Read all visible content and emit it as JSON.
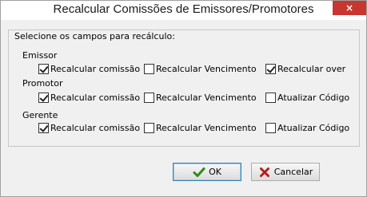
{
  "window": {
    "title": "Recalcular Comissões de Emissores/Promotores",
    "close_glyph": "×"
  },
  "group": {
    "title": "Selecione os campos para recálculo:"
  },
  "sections": [
    {
      "label": "Emissor",
      "options": [
        {
          "label": "Recalcular comissão",
          "checked": true
        },
        {
          "label": "Recalcular Vencimento",
          "checked": false
        },
        {
          "label": "Recalcular over",
          "checked": true
        }
      ]
    },
    {
      "label": "Promotor",
      "options": [
        {
          "label": "Recalcular comissão",
          "checked": true
        },
        {
          "label": "Recalcular Vencimento",
          "checked": false
        },
        {
          "label": "Atualizar Código",
          "checked": false
        }
      ]
    },
    {
      "label": "Gerente",
      "options": [
        {
          "label": "Recalcular comissão",
          "checked": true
        },
        {
          "label": "Recalcular Vencimento",
          "checked": false
        },
        {
          "label": "Atualizar Código",
          "checked": false
        }
      ]
    }
  ],
  "buttons": {
    "ok": {
      "label": "OK",
      "icon": "checkmark-icon"
    },
    "cancel": {
      "label": "Cancelar",
      "icon": "x-icon"
    }
  },
  "colors": {
    "close_button": "#c7372f",
    "ok_icon": "#2e8b16",
    "cancel_icon": "#b51e1e"
  }
}
